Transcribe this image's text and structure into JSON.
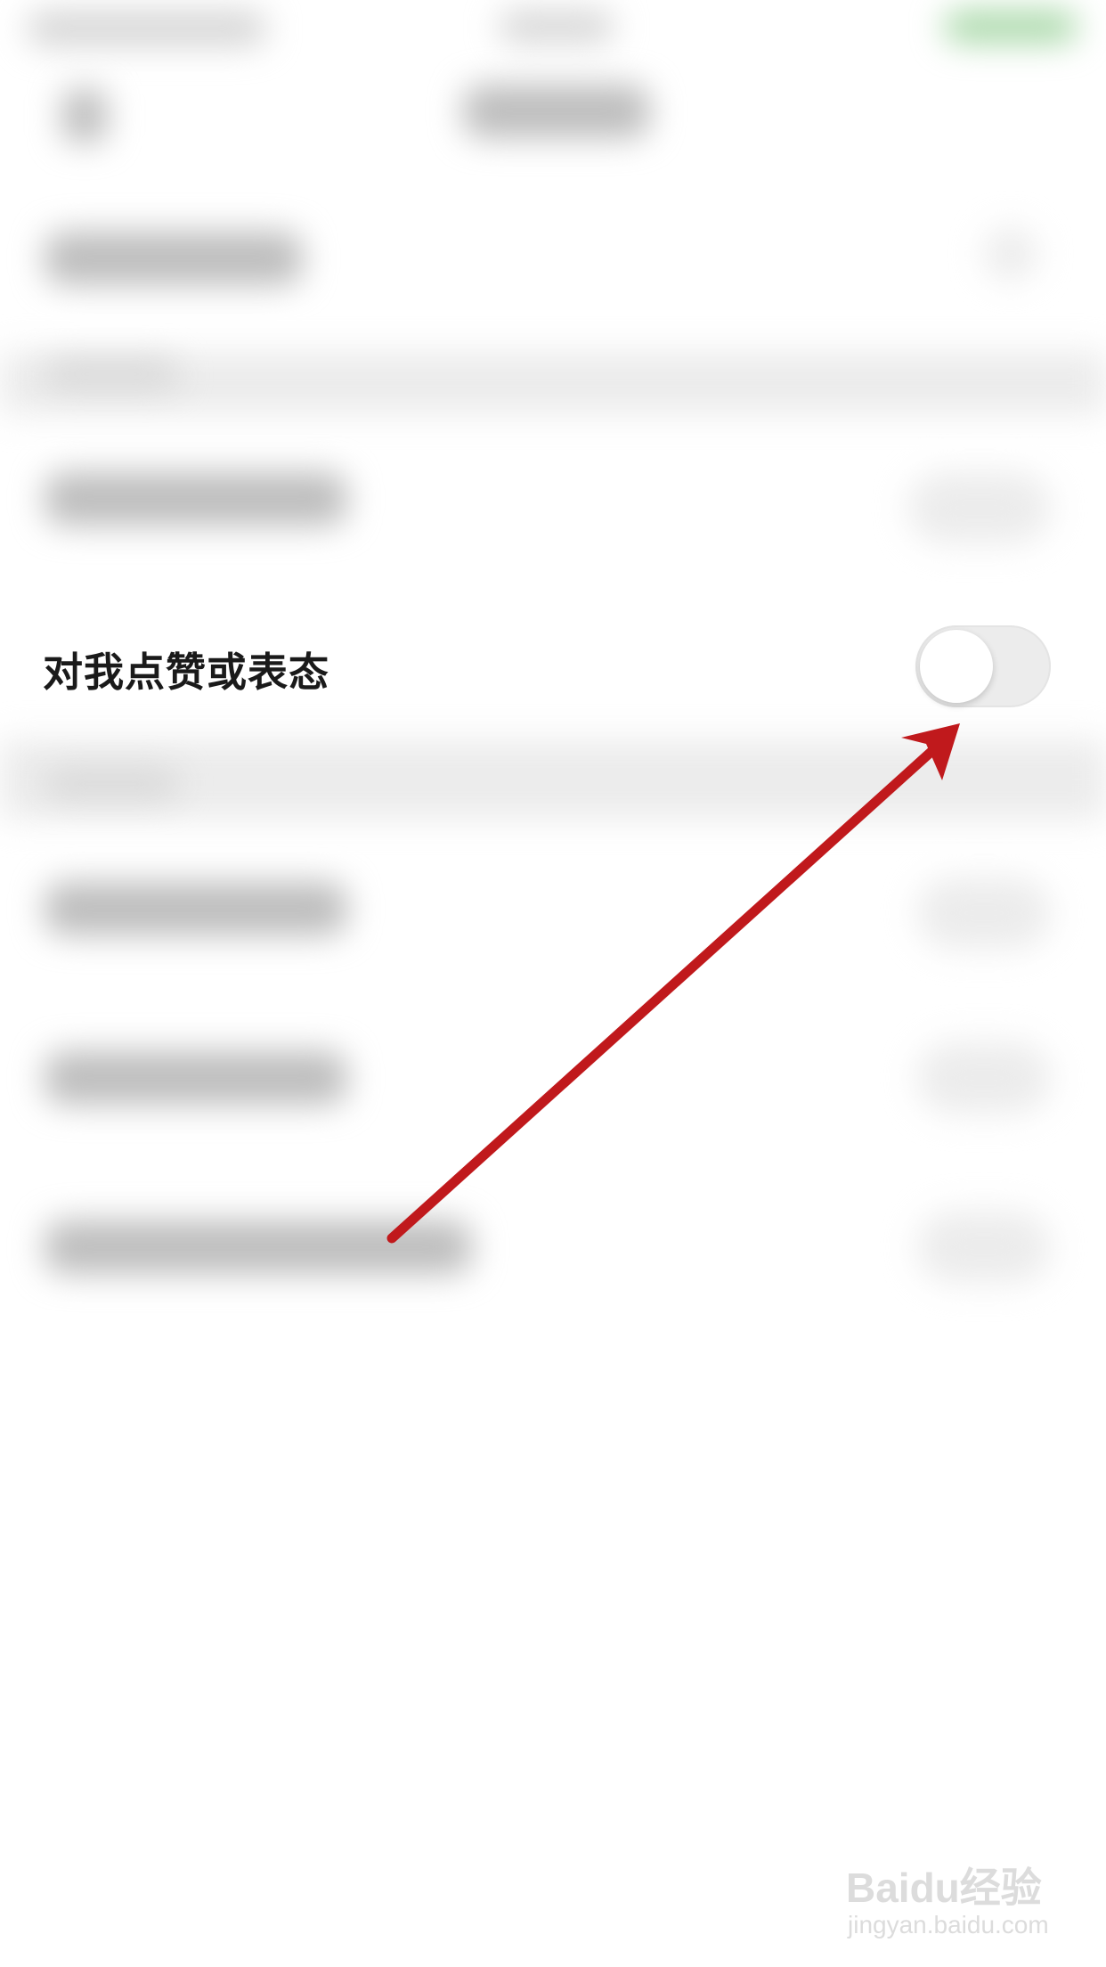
{
  "setting": {
    "label": "对我点赞或表态",
    "toggle_on": false
  },
  "annotation": {
    "arrow_color": "#c0191c"
  },
  "watermark": {
    "brand": "Baidu经验",
    "url": "jingyan.baidu.com"
  },
  "colors": {
    "background": "#ffffff",
    "toggle_off": "#ececec",
    "label_text": "#1a1a1a"
  }
}
